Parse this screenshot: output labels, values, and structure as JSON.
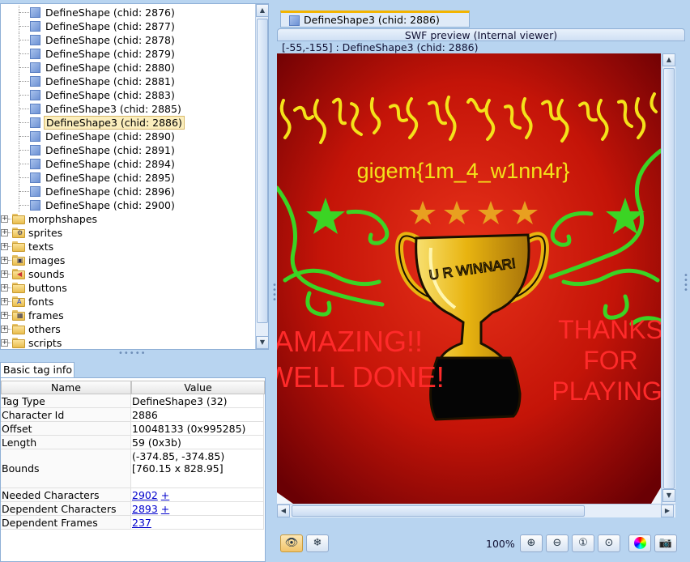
{
  "tree": {
    "children": [
      "DefineShape (chid: 2876)",
      "DefineShape (chid: 2877)",
      "DefineShape (chid: 2878)",
      "DefineShape (chid: 2879)",
      "DefineShape (chid: 2880)",
      "DefineShape (chid: 2881)",
      "DefineShape (chid: 2883)",
      "DefineShape3 (chid: 2885)",
      "DefineShape3 (chid: 2886)",
      "DefineShape (chid: 2890)",
      "DefineShape (chid: 2891)",
      "DefineShape (chid: 2894)",
      "DefineShape (chid: 2895)",
      "DefineShape (chid: 2896)",
      "DefineShape (chid: 2900)"
    ],
    "selected_child": "DefineShape3 (chid: 2886)",
    "folders": [
      "morphshapes",
      "sprites",
      "texts",
      "images",
      "sounds",
      "buttons",
      "fonts",
      "frames",
      "others",
      "scripts"
    ]
  },
  "info": {
    "tab_label": "Basic tag info",
    "col_name": "Name",
    "col_value": "Value",
    "rows": {
      "tag_type": {
        "name": "Tag Type",
        "value": "DefineShape3 (32)"
      },
      "character_id": {
        "name": "Character Id",
        "value": "2886"
      },
      "offset": {
        "name": "Offset",
        "value": "10048133 (0x995285)"
      },
      "length": {
        "name": "Length",
        "value": "59 (0x3b)"
      },
      "bounds": {
        "name": "Bounds",
        "value": "(-374.85, -374.85)[760.15 x 828.95]"
      },
      "needed": {
        "name": "Needed Characters",
        "link": "2902",
        "plus": "+"
      },
      "dependent": {
        "name": "Dependent Characters",
        "link": "2893",
        "plus": "+"
      },
      "frames": {
        "name": "Dependent Frames",
        "link": "237"
      }
    }
  },
  "preview": {
    "tab_label": "DefineShape3 (chid: 2886)",
    "header": "SWF preview (Internal viewer)",
    "coords": "[-55,-155] : DefineShape3 (chid: 2886)",
    "image": {
      "flag": "gigem{1m_4_w1nn4r}",
      "cup_text": "U R WINNAR!",
      "left_text_line1": "AMAZING!!",
      "left_text_line2": "WELL DONE!",
      "right_text_line1": "THANKS",
      "right_text_line2": "FOR",
      "right_text_line3": "PLAYING!",
      "bg_center": "#e8321a",
      "bg_edge": "#6a0004",
      "squiggle_color": "#f4e21a",
      "vine_color": "#3bd424",
      "red_text_color": "#ff2a2a",
      "gold": "#e8b410"
    },
    "zoom": "100%"
  },
  "icons": [
    "eye-icon",
    "snowflake-icon",
    "zoom-in-icon",
    "zoom-out-icon",
    "zoom-fit-icon",
    "zoom-reset-icon",
    "color-wheel-icon",
    "camera-icon"
  ]
}
